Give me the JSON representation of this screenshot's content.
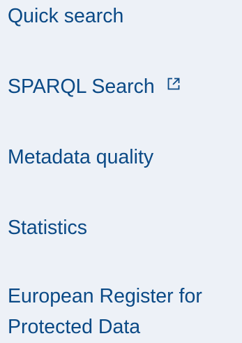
{
  "nav": {
    "items": [
      {
        "label": "Quick search"
      },
      {
        "label": "SPARQL Search",
        "icon": "external-link-icon"
      },
      {
        "label": "Metadata quality"
      },
      {
        "label": "Statistics"
      },
      {
        "label": "European Register for Protected Data"
      }
    ]
  },
  "colors": {
    "background": "#edf1f7",
    "link": "#0b4a86"
  }
}
